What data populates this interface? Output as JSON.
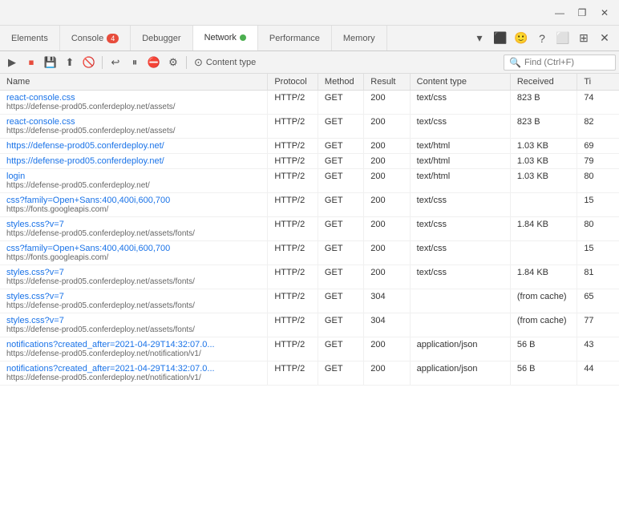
{
  "titlebar": {
    "minimize_label": "—",
    "maximize_label": "❐",
    "close_label": "✕"
  },
  "tabs": [
    {
      "id": "elements",
      "label": "Elements",
      "active": false,
      "badge": null
    },
    {
      "id": "console",
      "label": "Console",
      "active": false,
      "badge": "4"
    },
    {
      "id": "debugger",
      "label": "Debugger",
      "active": false,
      "badge": null
    },
    {
      "id": "network",
      "label": "Network",
      "active": true,
      "badge": null,
      "dot": true
    },
    {
      "id": "performance",
      "label": "Performance",
      "active": false,
      "badge": null
    },
    {
      "id": "memory",
      "label": "Memory",
      "active": false,
      "badge": null
    }
  ],
  "toolbar": {
    "filter_label": "Content type",
    "search_placeholder": "Find (Ctrl+F)"
  },
  "table": {
    "headers": [
      "Name",
      "Protocol",
      "Method",
      "Result",
      "Content type",
      "Received",
      "Ti"
    ],
    "rows": [
      {
        "name": "react-console.css",
        "url": "https://defense-prod05.conferdeploy.net/assets/",
        "protocol": "HTTP/2",
        "method": "GET",
        "result": "200",
        "content_type": "text/css",
        "received": "823 B",
        "time": "74"
      },
      {
        "name": "react-console.css",
        "url": "https://defense-prod05.conferdeploy.net/assets/",
        "protocol": "HTTP/2",
        "method": "GET",
        "result": "200",
        "content_type": "text/css",
        "received": "823 B",
        "time": "82"
      },
      {
        "name": "https://defense-prod05.conferdeploy.net/",
        "url": "",
        "protocol": "HTTP/2",
        "method": "GET",
        "result": "200",
        "content_type": "text/html",
        "received": "1.03 KB",
        "time": "69"
      },
      {
        "name": "https://defense-prod05.conferdeploy.net/",
        "url": "",
        "protocol": "HTTP/2",
        "method": "GET",
        "result": "200",
        "content_type": "text/html",
        "received": "1.03 KB",
        "time": "79"
      },
      {
        "name": "login",
        "url": "https://defense-prod05.conferdeploy.net/",
        "protocol": "HTTP/2",
        "method": "GET",
        "result": "200",
        "content_type": "text/html",
        "received": "1.03 KB",
        "time": "80"
      },
      {
        "name": "css?family=Open+Sans:400,400i,600,700",
        "url": "https://fonts.googleapis.com/",
        "protocol": "HTTP/2",
        "method": "GET",
        "result": "200",
        "content_type": "text/css",
        "received": "",
        "time": "15"
      },
      {
        "name": "styles.css?v=7",
        "url": "https://defense-prod05.conferdeploy.net/assets/fonts/",
        "protocol": "HTTP/2",
        "method": "GET",
        "result": "200",
        "content_type": "text/css",
        "received": "1.84 KB",
        "time": "80"
      },
      {
        "name": "css?family=Open+Sans:400,400i,600,700",
        "url": "https://fonts.googleapis.com/",
        "protocol": "HTTP/2",
        "method": "GET",
        "result": "200",
        "content_type": "text/css",
        "received": "",
        "time": "15"
      },
      {
        "name": "styles.css?v=7",
        "url": "https://defense-prod05.conferdeploy.net/assets/fonts/",
        "protocol": "HTTP/2",
        "method": "GET",
        "result": "200",
        "content_type": "text/css",
        "received": "1.84 KB",
        "time": "81"
      },
      {
        "name": "styles.css?v=7",
        "url": "https://defense-prod05.conferdeploy.net/assets/fonts/",
        "protocol": "HTTP/2",
        "method": "GET",
        "result": "304",
        "content_type": "",
        "received": "(from cache)",
        "time": "65"
      },
      {
        "name": "styles.css?v=7",
        "url": "https://defense-prod05.conferdeploy.net/assets/fonts/",
        "protocol": "HTTP/2",
        "method": "GET",
        "result": "304",
        "content_type": "",
        "received": "(from cache)",
        "time": "77"
      },
      {
        "name": "notifications?created_after=2021-04-29T14:32:07.0...",
        "url": "https://defense-prod05.conferdeploy.net/notification/v1/",
        "protocol": "HTTP/2",
        "method": "GET",
        "result": "200",
        "content_type": "application/json",
        "received": "56 B",
        "time": "43"
      },
      {
        "name": "notifications?created_after=2021-04-29T14:32:07.0...",
        "url": "https://defense-prod05.conferdeploy.net/notification/v1/",
        "protocol": "HTTP/2",
        "method": "GET",
        "result": "200",
        "content_type": "application/json",
        "received": "56 B",
        "time": "44"
      }
    ]
  },
  "icons": {
    "record": "⏺",
    "stop": "⏹",
    "save": "💾",
    "upload": "⬆",
    "clear": "🚫",
    "back": "↩",
    "pause": "⏸",
    "no_cache": "⛔",
    "filter": "⊙",
    "more": "⋯"
  }
}
